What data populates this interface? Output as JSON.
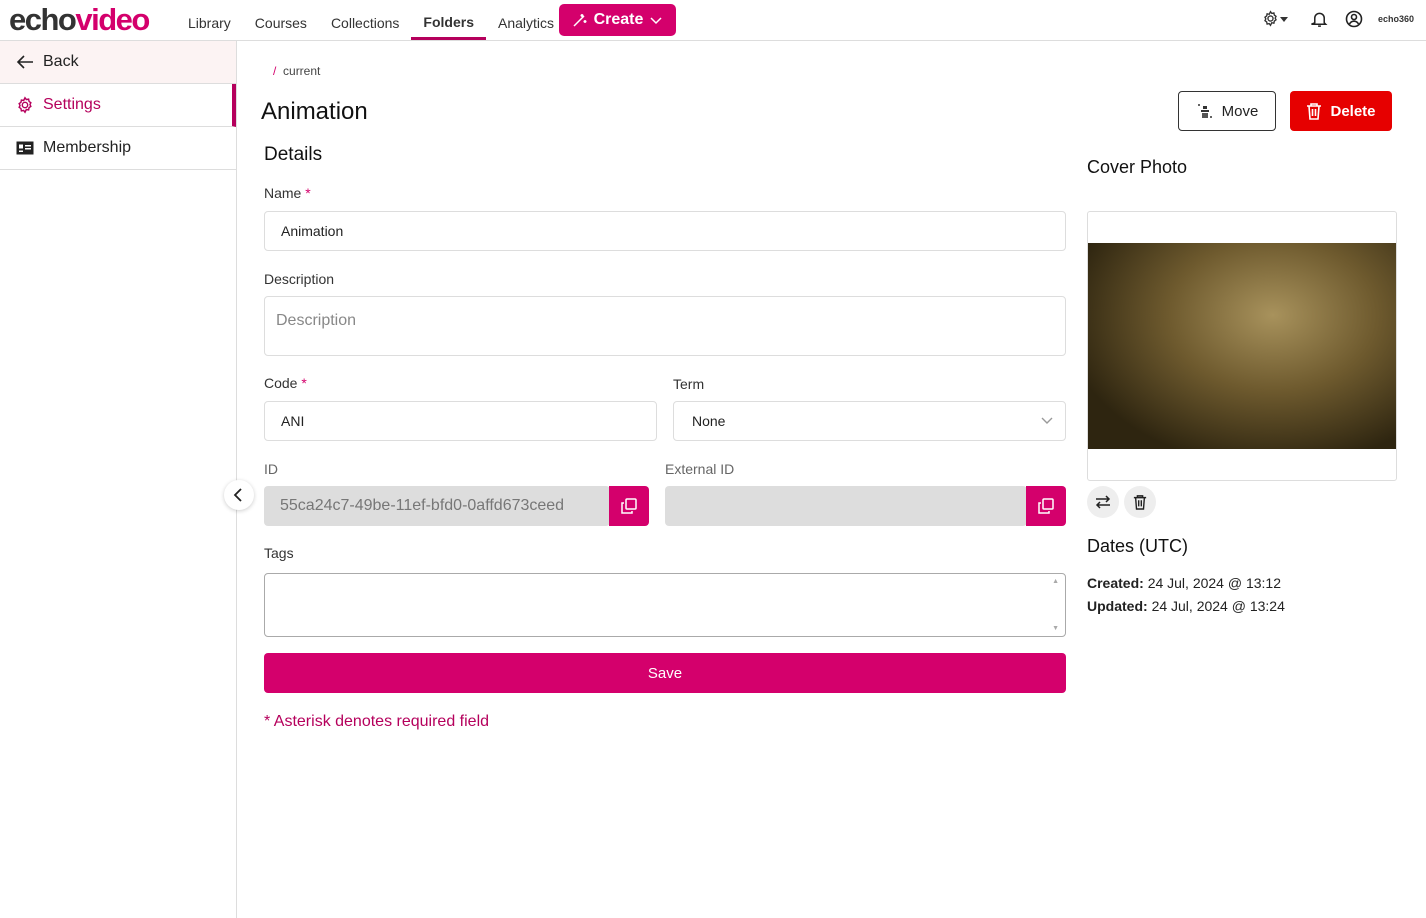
{
  "header": {
    "logo_a": "echo",
    "logo_b": "video",
    "nav": [
      "Library",
      "Courses",
      "Collections",
      "Folders",
      "Analytics"
    ],
    "active": "Folders",
    "create": "Create",
    "brand_small": "echo360"
  },
  "sidebar": {
    "items": [
      {
        "label": "Back",
        "icon": "arrow-left-icon"
      },
      {
        "label": "Settings",
        "icon": "gear-icon"
      },
      {
        "label": "Membership",
        "icon": "id-card-icon"
      }
    ]
  },
  "breadcrumb": {
    "sep": "/",
    "current": "current"
  },
  "page": {
    "title": "Animation",
    "move": "Move",
    "delete": "Delete"
  },
  "details": {
    "heading": "Details",
    "name_label": "Name",
    "name_value": "Animation",
    "desc_label": "Description",
    "desc_placeholder": "Description",
    "code_label": "Code",
    "code_value": "ANI",
    "term_label": "Term",
    "term_value": "None",
    "id_label": "ID",
    "id_value": "55ca24c7-49be-11ef-bfd0-0affd673ceed",
    "ext_label": "External ID",
    "ext_value": "",
    "tags_label": "Tags",
    "save": "Save",
    "required_note": "* Asterisk denotes required field",
    "asterisk": "*"
  },
  "cover": {
    "heading": "Cover Photo"
  },
  "dates": {
    "heading": "Dates (UTC)",
    "created_label": "Created:",
    "created": "24 Jul, 2024 @ 13:12",
    "updated_label": "Updated:",
    "updated": "24 Jul, 2024 @ 13:24"
  },
  "colors": {
    "accent": "#d4006c",
    "danger": "#e60000"
  }
}
